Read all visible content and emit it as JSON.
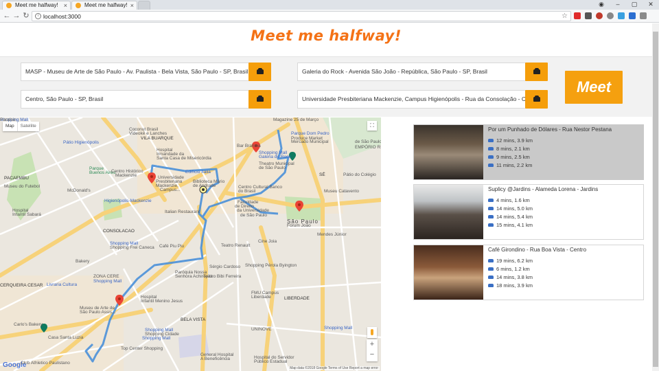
{
  "browser": {
    "tabs": [
      {
        "title": "Meet me halfway!"
      },
      {
        "title": "Meet me halfway!"
      }
    ],
    "url": "localhost:3000"
  },
  "app": {
    "title": "Meet me halfway!",
    "meet_label": "Meet",
    "addresses": [
      "MASP - Museu de Arte de São Paulo - Av. Paulista - Bela Vista, São Paulo - SP, Brasil",
      "Galeria do Rock - Avenida São João - República, São Paulo - SP, Brasil",
      "Centro, São Paulo - SP, Brasil",
      "Universidade Presbiteriana Mackenzie, Campus Higienópolis - Rua da Consolação - Con"
    ]
  },
  "map": {
    "type_map": "Map",
    "type_satellite": "Satellite",
    "zoom_in": "+",
    "zoom_out": "−",
    "logo": "Google",
    "footer": "Map data ©2018 Google   Terms of Use   Report a map error",
    "labels": [
      {
        "text": "Coconut Brasil",
        "cls": ""
      },
      {
        "text": "Videokê e Lanches",
        "cls": ""
      },
      {
        "text": "VILA BUARQUE",
        "cls": "dark"
      },
      {
        "text": "Pátio Higienópolis",
        "cls": "blue"
      },
      {
        "text": "Hospital",
        "cls": ""
      },
      {
        "text": "Irmandade da",
        "cls": ""
      },
      {
        "text": "Santa Casa de Misericórdia",
        "cls": ""
      },
      {
        "text": "PACAEMBU",
        "cls": "dark"
      },
      {
        "text": "Parque",
        "cls": "green"
      },
      {
        "text": "Buenos Aires",
        "cls": "green"
      },
      {
        "text": "Centro Histórico",
        "cls": ""
      },
      {
        "text": "Mackenzie",
        "cls": ""
      },
      {
        "text": "Universidade",
        "cls": ""
      },
      {
        "text": "Presbiteriana",
        "cls": ""
      },
      {
        "text": "Mackenzie,",
        "cls": ""
      },
      {
        "text": "Campus...",
        "cls": ""
      },
      {
        "text": "Museu do Futebol",
        "cls": ""
      },
      {
        "text": "McDonald's",
        "cls": ""
      },
      {
        "text": "Higienópolis-Mackenzie",
        "cls": "blue"
      },
      {
        "text": "Hospital",
        "cls": ""
      },
      {
        "text": "Infantil Sabará",
        "cls": ""
      },
      {
        "text": "Italian Restaurant",
        "cls": ""
      },
      {
        "text": "CONSOLACAO",
        "cls": "dark"
      },
      {
        "text": "Shopping Mall",
        "cls": "blue"
      },
      {
        "text": "Shopping Frei Caneca",
        "cls": ""
      },
      {
        "text": "Café Piu Piu",
        "cls": ""
      },
      {
        "text": "Bakery",
        "cls": ""
      },
      {
        "text": "Shopping Mall",
        "cls": "blue"
      },
      {
        "text": "Livraria Cultura",
        "cls": "blue"
      },
      {
        "text": "CERQUEIRA CESAR",
        "cls": "dark"
      },
      {
        "text": "Museu de Arte de",
        "cls": ""
      },
      {
        "text": "São Paulo Assis...",
        "cls": ""
      },
      {
        "text": "Carlo's Bakery",
        "cls": ""
      },
      {
        "text": "Casa Santa Luzia",
        "cls": ""
      },
      {
        "text": "Club Athletico Paulistano",
        "cls": ""
      },
      {
        "text": "Hospital",
        "cls": ""
      },
      {
        "text": "Infantil Menino Jesus",
        "cls": ""
      },
      {
        "text": "BELA VISTA",
        "cls": "dark"
      },
      {
        "text": "Shopping Mall",
        "cls": "blue"
      },
      {
        "text": "Shopping Cidade",
        "cls": ""
      },
      {
        "text": "Top Center Shopping",
        "cls": ""
      },
      {
        "text": "Sérgio Cardoso",
        "cls": ""
      },
      {
        "text": "Teatro Bibi Ferreira",
        "cls": ""
      },
      {
        "text": "Paróquia Nossa",
        "cls": ""
      },
      {
        "text": "Senhora Achiropita",
        "cls": ""
      },
      {
        "text": "Teatro Renault",
        "cls": ""
      },
      {
        "text": "Shopping Pérola Byington",
        "cls": ""
      },
      {
        "text": "Cine Joia",
        "cls": ""
      },
      {
        "text": "LIBERDADE",
        "cls": "dark"
      },
      {
        "text": "FMU Campus",
        "cls": ""
      },
      {
        "text": "Liberdade",
        "cls": ""
      },
      {
        "text": "UNINOVE",
        "cls": ""
      },
      {
        "text": "General Hospital",
        "cls": ""
      },
      {
        "text": "A Beneficência",
        "cls": ""
      },
      {
        "text": "Hospital do Servidor",
        "cls": ""
      },
      {
        "text": "Público Estadual",
        "cls": ""
      },
      {
        "text": "Magazine 25 de Março",
        "cls": ""
      },
      {
        "text": "Bar Brahma",
        "cls": ""
      },
      {
        "text": "Shopping Mall",
        "cls": "blue"
      },
      {
        "text": "Galeria do Rock",
        "cls": "blue"
      },
      {
        "text": "Theatro Municipal",
        "cls": ""
      },
      {
        "text": "de São Paulo",
        "cls": ""
      },
      {
        "text": "Edifício Itália",
        "cls": "blue"
      },
      {
        "text": "Biblioteca Mário",
        "cls": ""
      },
      {
        "text": "de Andrade",
        "cls": ""
      },
      {
        "text": "Centro Cultural Banco",
        "cls": ""
      },
      {
        "text": "do Brasil",
        "cls": ""
      },
      {
        "text": "Faculdade",
        "cls": ""
      },
      {
        "text": "de Direito",
        "cls": ""
      },
      {
        "text": "da Universidade",
        "cls": ""
      },
      {
        "text": "de São Paulo",
        "cls": ""
      },
      {
        "text": "São Paulo",
        "cls": "big"
      },
      {
        "text": "Fórum João",
        "cls": ""
      },
      {
        "text": "Mendes Júnior",
        "cls": ""
      },
      {
        "text": "SÉ",
        "cls": "dark"
      },
      {
        "text": "Museu Catavento",
        "cls": ""
      },
      {
        "text": "Pátio do Colégio",
        "cls": ""
      },
      {
        "text": "Parque Dom Pedro",
        "cls": "blue"
      },
      {
        "text": "Produce Market",
        "cls": ""
      },
      {
        "text": "Mercado Municipal",
        "cls": ""
      },
      {
        "text": "de São Paulo",
        "cls": ""
      },
      {
        "text": "EMPÓRIO RI",
        "cls": ""
      },
      {
        "text": "ZONA CERE",
        "cls": ""
      },
      {
        "text": "Shopping Mall",
        "cls": "blue"
      },
      {
        "text": "Shopping Mall",
        "cls": "blue"
      },
      {
        "text": "Shopping Mall",
        "cls": "blue"
      },
      {
        "text": "Paraíso",
        "cls": ""
      }
    ]
  },
  "results": [
    {
      "name": "Por um Punhado de Dólares - Rua Nestor Pestana",
      "times": [
        "12 mins, 3.9 km",
        "8 mins, 2.1 km",
        "9 mins, 2.5 km",
        "11 mins, 2.2 km"
      ]
    },
    {
      "name": "Suplicy @Jardins - Alameda Lorena - Jardins",
      "times": [
        "4 mins, 1.6 km",
        "14 mins, 5.0 km",
        "14 mins, 5.4 km",
        "15 mins, 4.1 km"
      ]
    },
    {
      "name": "Café Girondino - Rua Boa Vista - Centro",
      "times": [
        "19 mins, 6.2 km",
        "6 mins, 1.2 km",
        "14 mins, 3.8 km",
        "18 mins, 3.9 km"
      ]
    }
  ],
  "colors": {
    "accent": "#f47216",
    "button": "#f59e0b",
    "route": "#4a90d9"
  }
}
